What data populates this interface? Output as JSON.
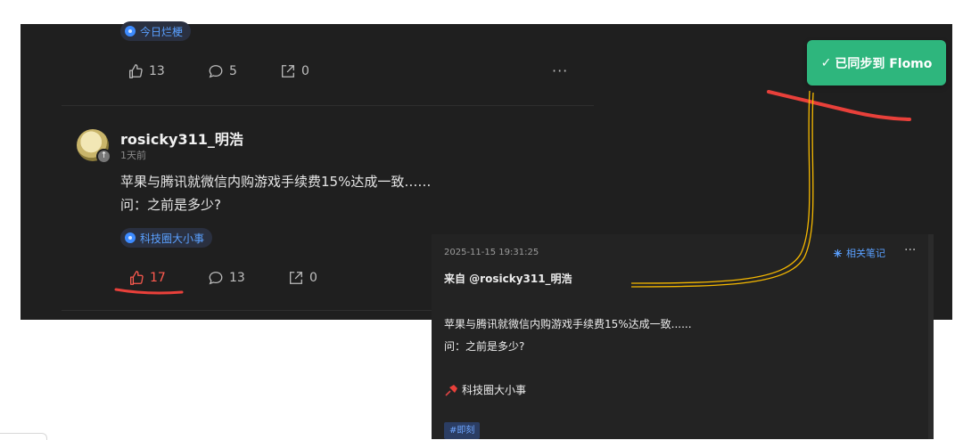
{
  "feed": {
    "prev_post": {
      "topic": "今日烂梗",
      "likes": "13",
      "comments": "5",
      "shares": "0",
      "more": "···"
    },
    "post": {
      "username": "rosicky311_明浩",
      "time": "1天前",
      "line1": "苹果与腾讯就微信内购游戏手续费15%达成一致……",
      "line2": "问：之前是多少?",
      "topic": "科技圈大小事",
      "likes": "17",
      "comments": "13",
      "shares": "0"
    }
  },
  "toast": {
    "check": "✓",
    "text": "已同步到 Flomo"
  },
  "note_card": {
    "timestamp": "2025-11-15 19:31:25",
    "related": "相关笔记",
    "more": "···",
    "from": "来自 @rosicky311_明浩",
    "line1": "苹果与腾讯就微信内购游戏手续费15%达成一致......",
    "line2": "问：之前是多少?",
    "pin_text": "科技圈大小事",
    "tag": "#即刻"
  },
  "colors": {
    "feed_bg": "#1f1f1f",
    "accent_blue": "#3d8bff",
    "like_active": "#ff5a4f",
    "toast_green": "#2eb67d",
    "annotation_red": "#e8403a",
    "annotation_yellow": "#f5b800"
  }
}
